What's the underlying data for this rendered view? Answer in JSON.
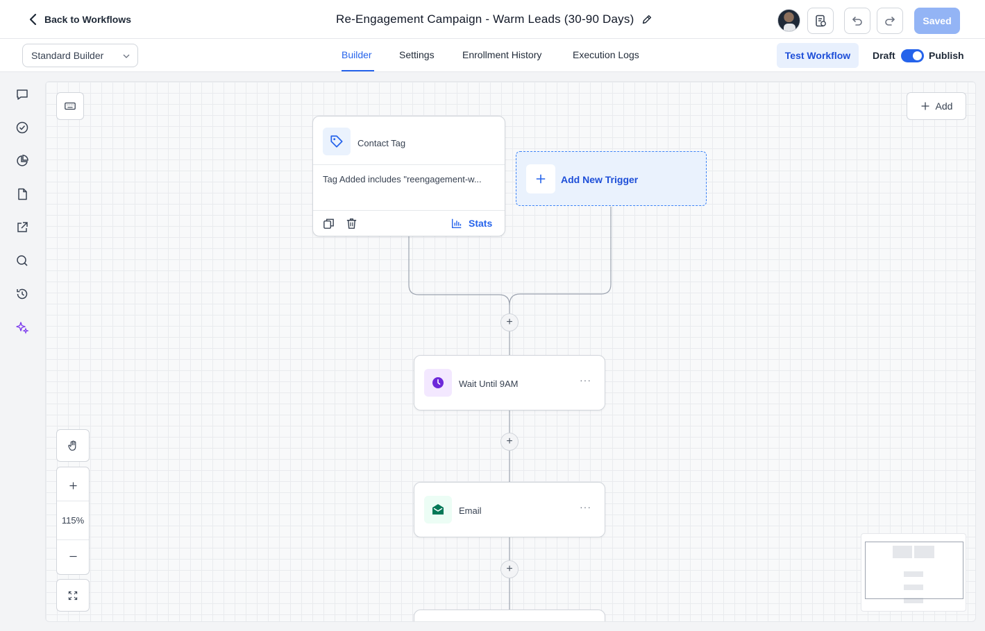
{
  "header": {
    "back_label": "Back to Workflows",
    "title": "Re-Engagement Campaign - Warm Leads (30-90 Days)",
    "saved_label": "Saved"
  },
  "subbar": {
    "builder_select": "Standard Builder",
    "tabs": [
      {
        "label": "Builder",
        "active": true
      },
      {
        "label": "Settings",
        "active": false
      },
      {
        "label": "Enrollment History",
        "active": false
      },
      {
        "label": "Execution Logs",
        "active": false
      }
    ],
    "test_workflow_label": "Test Workflow",
    "draft_label": "Draft",
    "publish_label": "Publish",
    "published": true
  },
  "sidebar": {
    "icons": [
      "chat-icon",
      "check-circle-icon",
      "pie-chart-icon",
      "document-icon",
      "external-link-icon",
      "search-icon",
      "history-icon",
      "sparkles-icon"
    ]
  },
  "canvas": {
    "add_label": "Add",
    "trigger": {
      "title": "Contact Tag",
      "condition": "Tag Added includes \"reengagement-w...",
      "stats_label": "Stats"
    },
    "add_trigger_label": "Add New Trigger",
    "actions": [
      {
        "label": "Wait Until 9AM",
        "icon": "clock-icon"
      },
      {
        "label": "Email",
        "icon": "email-icon"
      }
    ],
    "zoom_level": "115%"
  },
  "colors": {
    "accent": "#2563eb",
    "saved_button": "#93b4f5",
    "wait_icon": "#6d28d9",
    "email_icon": "#047857"
  }
}
